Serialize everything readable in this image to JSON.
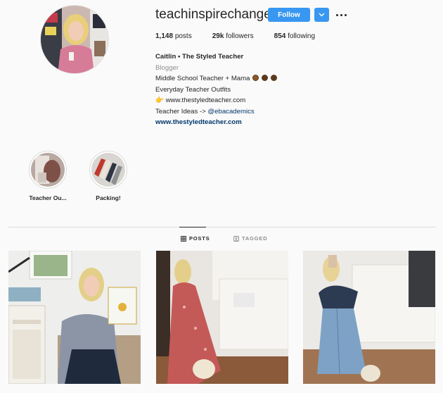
{
  "profile": {
    "username": "teachinspirechange",
    "follow_label": "Follow",
    "stats": {
      "posts_count": "1,148",
      "posts_label": "posts",
      "followers_count": "29k",
      "followers_label": "followers",
      "following_count": "854",
      "following_label": "following"
    },
    "bio": {
      "name": "Caitlin • The Styled Teacher",
      "category": "Blogger",
      "line1": "Middle School Teacher + Mama",
      "line2": "Everyday Teacher Outfits",
      "line3_icon": "👉",
      "line3": "www.thestyledteacher.com",
      "line4_prefix": "Teacher Ideas -> ",
      "line4_mention": "@ebacademics",
      "website": "www.thestyledteacher.com"
    }
  },
  "highlights": [
    {
      "label": "Teacher Ou..."
    },
    {
      "label": "Packing!"
    }
  ],
  "tabs": [
    {
      "label": "POSTS",
      "active": true
    },
    {
      "label": "TAGGED",
      "active": false
    }
  ],
  "colors": {
    "accent": "#3897f0",
    "link": "#00376b",
    "muted": "#8e8e8e"
  }
}
